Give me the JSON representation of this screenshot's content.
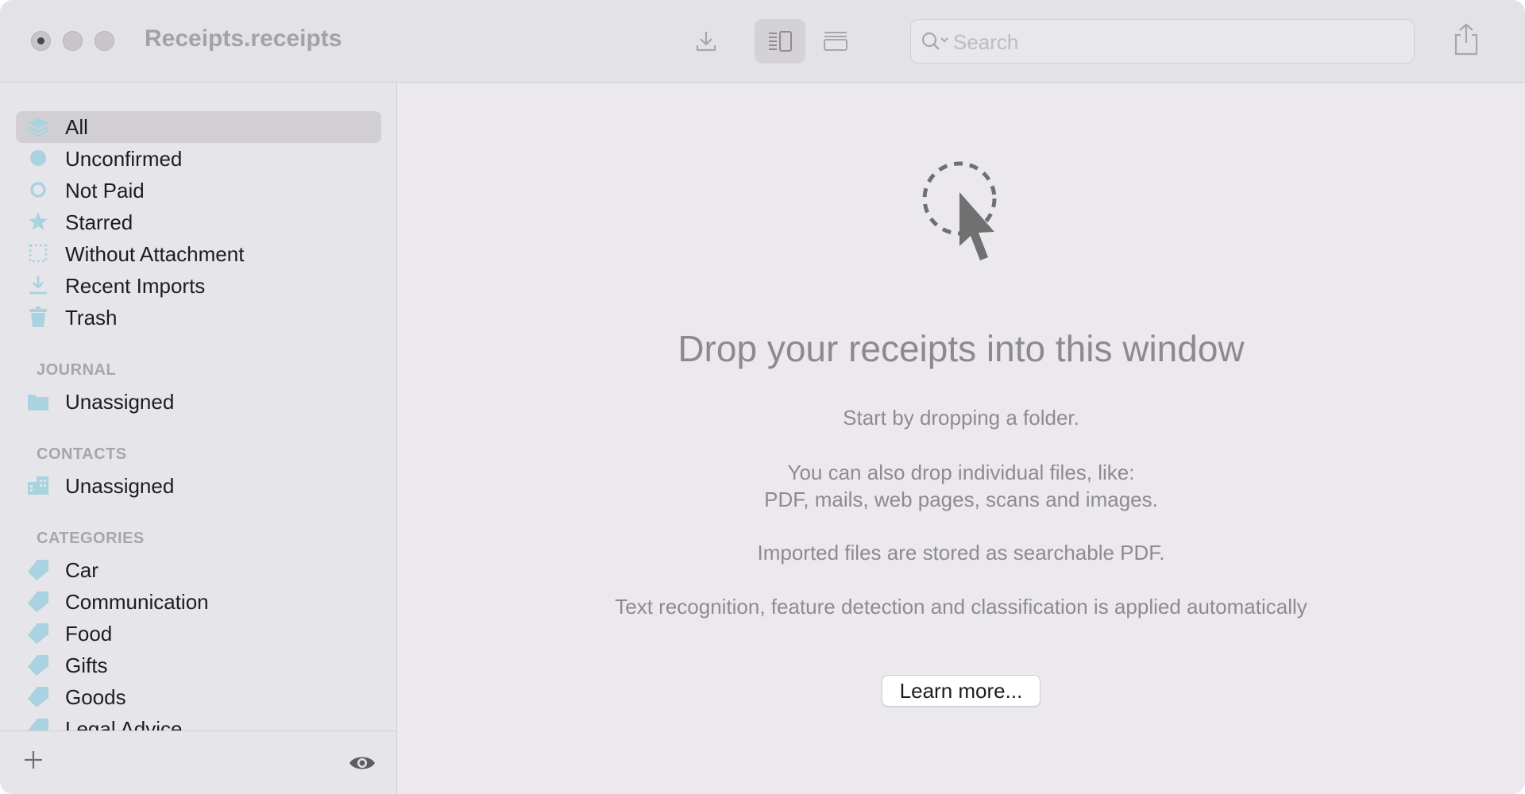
{
  "window": {
    "title": "Receipts.receipts"
  },
  "toolbar": {
    "import_icon": "download-icon",
    "view_split_icon": "split-view-icon",
    "view_list_icon": "list-view-icon",
    "share_icon": "share-icon"
  },
  "search": {
    "placeholder": "Search"
  },
  "sidebar": {
    "smart_items": [
      {
        "label": "All",
        "icon": "stack-icon"
      },
      {
        "label": "Unconfirmed",
        "icon": "filled-dot-icon"
      },
      {
        "label": "Not Paid",
        "icon": "ring-icon"
      },
      {
        "label": "Starred",
        "icon": "star-icon"
      },
      {
        "label": "Without Attachment",
        "icon": "dotted-square-icon"
      },
      {
        "label": "Recent Imports",
        "icon": "download-icon"
      },
      {
        "label": "Trash",
        "icon": "trash-icon"
      }
    ],
    "journal": {
      "heading": "JOURNAL",
      "items": [
        {
          "label": "Unassigned",
          "icon": "folder-icon"
        }
      ]
    },
    "contacts": {
      "heading": "CONTACTS",
      "items": [
        {
          "label": "Unassigned",
          "icon": "building-icon"
        }
      ]
    },
    "categories": {
      "heading": "CATEGORIES",
      "items": [
        {
          "label": "Car",
          "icon": "tag-icon"
        },
        {
          "label": "Communication",
          "icon": "tag-icon"
        },
        {
          "label": "Food",
          "icon": "tag-icon"
        },
        {
          "label": "Gifts",
          "icon": "tag-icon"
        },
        {
          "label": "Goods",
          "icon": "tag-icon"
        },
        {
          "label": "Legal Advice",
          "icon": "tag-icon"
        }
      ]
    }
  },
  "main": {
    "headline": "Drop your receipts into this window",
    "line1": "Start by dropping a folder.",
    "line2a": "You can also drop individual files, like:",
    "line2b": "PDF, mails, web pages, scans and images.",
    "line3": "Imported files are stored as searchable PDF.",
    "line4": "Text recognition, feature detection and classification is applied automatically",
    "learn_more": "Learn more..."
  },
  "colors": {
    "icon_accent": "#a9d3e0",
    "sidebar_selected": "#d1cfd4",
    "accent_gray": "#8c8a8f"
  }
}
